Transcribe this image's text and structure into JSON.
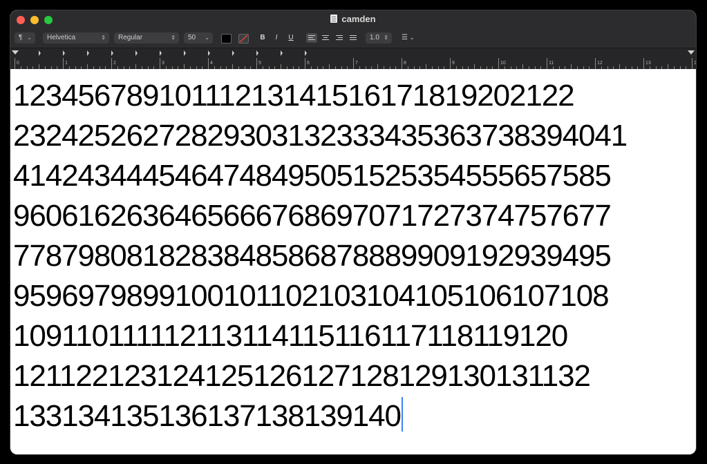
{
  "window": {
    "title": "camden"
  },
  "toolbar": {
    "paragraph_label": "¶",
    "font_family": "Helvetica",
    "font_style": "Regular",
    "font_size": "50",
    "text_color": "#000000",
    "bold_label": "B",
    "italic_label": "I",
    "underline_label": "U",
    "line_spacing": "1.0",
    "list_label": "☰"
  },
  "ruler": {
    "numbers": [
      "0",
      "1",
      "2",
      "3",
      "4",
      "5",
      "6",
      "7",
      "8",
      "9",
      "10",
      "11",
      "12",
      "13",
      "1"
    ]
  },
  "document": {
    "lines": [
      "12345678910111213141516171819202122",
      "23242526272829303132333435363738394041",
      "4142434445464748495051525354555657585",
      "9606162636465666768697071727374757677",
      "7787980818283848586878889909192939495",
      "9596979899100101102103104105106107108",
      "109110111112113114115116117118119120",
      "121122123124125126127128129130131132",
      "133134135136137138139140"
    ]
  },
  "colors": {
    "accent": "#3b82f6",
    "chrome": "#2c2c2e"
  }
}
